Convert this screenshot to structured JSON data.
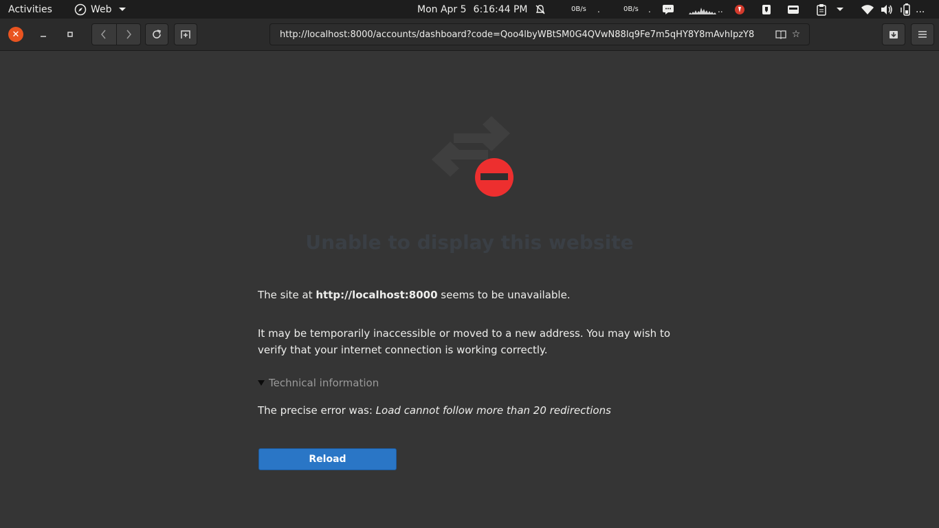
{
  "topbar": {
    "activities": "Activities",
    "app_name": "Web",
    "date": "Mon Apr 5",
    "time": "6:16:44 PM",
    "net_down": "0B/s",
    "net_up": "0B/s",
    "overflow": "..."
  },
  "browser": {
    "url": "http://localhost:8000/accounts/dashboard?code=Qoo4lbyWBtSM0G4QVwN88lq9Fe7m5qHY8Y8mAvhIpzY8",
    "icons": {
      "close": "close-icon",
      "minimize": "minimize-icon",
      "maximize": "maximize-icon",
      "back": "back-icon",
      "forward": "forward-icon",
      "reload": "reload-icon",
      "new_tab": "new-tab-icon",
      "reader": "reader-mode-icon",
      "bookmark": "star-icon",
      "downloads": "downloads-icon",
      "menu": "hamburger-menu-icon"
    }
  },
  "error_page": {
    "title": "Unable to display this website",
    "msg1_prefix": "The site at ",
    "msg1_host": "http://localhost:8000",
    "msg1_suffix": " seems to be unavailable.",
    "msg2": "It may be temporarily inaccessible or moved to a new address. You may wish to verify that your internet connection is working correctly.",
    "technical_label": "Technical information",
    "precise_prefix": "The precise error was: ",
    "precise_error": "Load cannot follow more than 20 redirections",
    "reload_label": "Reload"
  },
  "colors": {
    "accent": "#2a76c6",
    "error_red": "#ed2f2f",
    "window_close": "#e95420",
    "background": "#353535"
  }
}
